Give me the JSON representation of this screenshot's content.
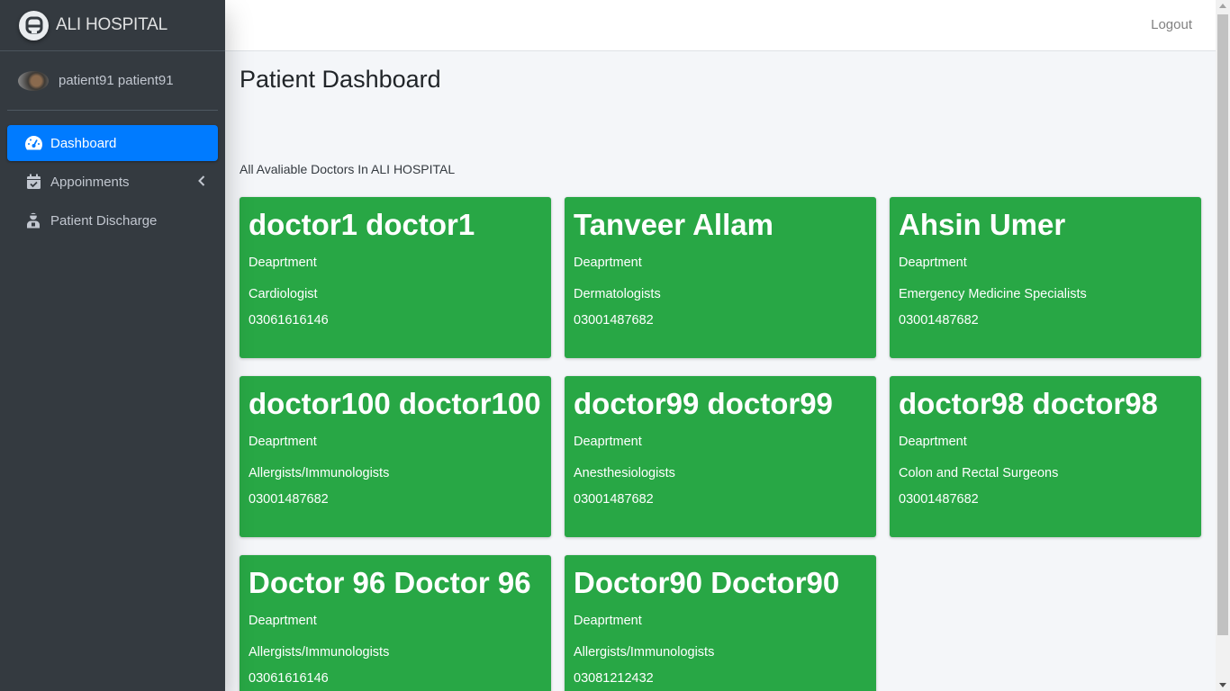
{
  "app": {
    "brand": "ALI HOSPITAL"
  },
  "user": {
    "name": "patient91 patient91"
  },
  "sidebar": {
    "items": [
      {
        "label": "Dashboard",
        "icon": "tachometer-icon",
        "active": true
      },
      {
        "label": "Appoinments",
        "icon": "calendar-check-icon",
        "active": false
      },
      {
        "label": "Patient Discharge",
        "icon": "user-injured-icon",
        "active": false
      }
    ]
  },
  "header": {
    "logout_label": "Logout"
  },
  "main": {
    "title": "Patient Dashboard",
    "subtitle": "All Avaliable Doctors In ALI HOSPITAL",
    "doctors": [
      {
        "name": "doctor1 doctor1",
        "dept_label": "Deaprtment",
        "specialty": "Cardiologist",
        "phone": "03061616146"
      },
      {
        "name": "Tanveer Allam",
        "dept_label": "Deaprtment",
        "specialty": "Dermatologists",
        "phone": "03001487682"
      },
      {
        "name": "Ahsin Umer",
        "dept_label": "Deaprtment",
        "specialty": "Emergency Medicine Specialists",
        "phone": "03001487682"
      },
      {
        "name": "doctor100 doctor100",
        "dept_label": "Deaprtment",
        "specialty": "Allergists/Immunologists",
        "phone": "03001487682"
      },
      {
        "name": "doctor99 doctor99",
        "dept_label": "Deaprtment",
        "specialty": "Anesthesiologists",
        "phone": "03001487682"
      },
      {
        "name": "doctor98 doctor98",
        "dept_label": "Deaprtment",
        "specialty": "Colon and Rectal Surgeons",
        "phone": "03001487682"
      },
      {
        "name": "Doctor 96 Doctor 96",
        "dept_label": "Deaprtment",
        "specialty": "Allergists/Immunologists",
        "phone": "03061616146"
      },
      {
        "name": "Doctor90 Doctor90",
        "dept_label": "Deaprtment",
        "specialty": "Allergists/Immunologists",
        "phone": "03081212432"
      }
    ]
  },
  "colors": {
    "sidebar": "#343a40",
    "active": "#007bff",
    "card": "#28a745",
    "background": "#f4f6f9"
  }
}
